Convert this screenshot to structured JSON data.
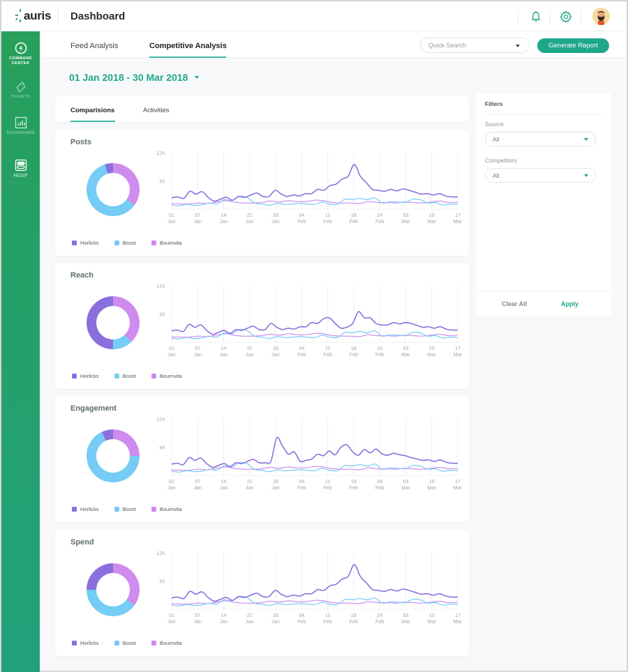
{
  "app": {
    "logo": "auris",
    "page_title": "Dashboard"
  },
  "colors": {
    "brand": "#1fa78a",
    "horlicks": "#8a6fdd",
    "boost": "#75ccf5",
    "bournvita": "#cd8cee"
  },
  "sidebar": {
    "items": [
      {
        "label": "COMMAND CENTER",
        "icon": "bolt-icon",
        "active": true
      },
      {
        "label": "TICKETS",
        "icon": "ticket-icon",
        "active": false
      },
      {
        "label": "DASHBOARD",
        "icon": "bar-chart-icon",
        "active": false
      },
      {
        "label": "SETUP",
        "icon": "toggle-icon",
        "active": false
      }
    ]
  },
  "subnav": {
    "tabs": [
      {
        "label": "Feed Analysis"
      },
      {
        "label": "Competitive Analysis"
      }
    ],
    "search_placeholder": "Quick Search",
    "generate_label": "Generate Report"
  },
  "date_range": "01 Jan 2018 - 30 Mar 2018",
  "content_tabs": [
    {
      "label": "Comparisions"
    },
    {
      "label": "Activities"
    }
  ],
  "filters": {
    "title": "Filters",
    "source_label": "Source",
    "source_value": "All",
    "competitors_label": "Competitors",
    "competitors_value": "All",
    "clear_label": "Clear All",
    "apply_label": "Apply"
  },
  "legend": [
    "Horlicks",
    "Boost",
    "Bournvita"
  ],
  "chart_data": [
    {
      "type": "line",
      "title": "Posts",
      "donut": {
        "type": "pie",
        "values": [
          5,
          60,
          35
        ],
        "labels": [
          "Horlicks",
          "Boost",
          "Bournvita"
        ]
      },
      "x": [
        "01 Jan",
        "07 Jan",
        "14 Jan",
        "21 Jan",
        "28 Jan",
        "04 Feb",
        "11 Feb",
        "18 Feb",
        "24 Feb",
        "03 Mar",
        "10 Mar",
        "17 Mar"
      ],
      "y_ticks": [
        "12K",
        "6K"
      ],
      "ylim": [
        0,
        12000
      ],
      "series": [
        {
          "name": "Horlicks",
          "values": [
            2400,
            2600,
            2300,
            3800,
            3200,
            3700,
            2500,
            1700,
            2100,
            2500,
            1900,
            2700,
            2500,
            3000,
            3400,
            2700,
            2700,
            4000,
            3200,
            2700,
            3000,
            2800,
            3300,
            3300,
            4200,
            4000,
            5000,
            5300,
            6400,
            7000,
            9500,
            7000,
            5600,
            4200,
            4000,
            3800,
            4200,
            3900,
            4300,
            4000,
            3600,
            3200,
            3300,
            3000,
            3300,
            2800,
            2600,
            2600
          ]
        },
        {
          "name": "Boost",
          "values": [
            900,
            700,
            1000,
            800,
            900,
            1300,
            1100,
            2000,
            1800,
            2700,
            2500,
            1300,
            1100,
            800,
            1200,
            1000,
            1100,
            1200,
            1100,
            1000,
            1500,
            1100,
            1000,
            2100,
            2000,
            2300,
            2000,
            2400,
            1300,
            1600,
            1500,
            1400,
            2100,
            2000,
            1300,
            1400,
            900,
            1100,
            1000
          ]
        },
        {
          "name": "Bournvita",
          "values": [
            1200,
            1100,
            1100,
            1300,
            1200,
            1500,
            1800,
            1500,
            1300,
            1300,
            1400,
            1700,
            1500,
            1800,
            1600,
            1600,
            1900,
            1800,
            1400,
            1300,
            1300,
            1200,
            1600,
            1400,
            1400,
            1300,
            1500,
            1400,
            1300,
            1500,
            1700,
            1400,
            1500
          ]
        }
      ]
    },
    {
      "type": "line",
      "title": "Reach",
      "donut": {
        "type": "pie",
        "values": [
          50,
          12,
          38
        ],
        "labels": [
          "Horlicks",
          "Boost",
          "Bournvita"
        ]
      },
      "x": [
        "01 Jan",
        "07 Jan",
        "14 Jan",
        "21 Jan",
        "28 Jan",
        "04 Feb",
        "11 Feb",
        "18 Feb",
        "24 Feb",
        "03 Mar",
        "10 Mar",
        "17 Mar"
      ],
      "y_ticks": [
        "12K",
        "6K"
      ],
      "ylim": [
        0,
        12000
      ],
      "series": [
        {
          "name": "Horlicks",
          "values": [
            2400,
            2600,
            2300,
            3800,
            3200,
            3700,
            2500,
            1700,
            2100,
            2500,
            1900,
            2700,
            2500,
            3000,
            3400,
            2700,
            2700,
            4000,
            3200,
            2700,
            3000,
            2800,
            3300,
            3300,
            4200,
            4000,
            5000,
            5200,
            4000,
            3000,
            3200,
            4000,
            6500,
            5200,
            5200,
            4000,
            3700,
            3700,
            4200,
            3900,
            4200,
            4000,
            3600,
            3200,
            3300,
            3000,
            3300,
            2800,
            2600,
            2600
          ]
        },
        {
          "name": "Boost",
          "values": [
            900,
            700,
            1000,
            800,
            900,
            1300,
            1100,
            2000,
            1800,
            2700,
            2500,
            1300,
            1100,
            800,
            1200,
            1000,
            1100,
            1200,
            1100,
            1000,
            1500,
            1100,
            1000,
            2100,
            2000,
            2300,
            2000,
            2400,
            1300,
            1600,
            1500,
            1400,
            2100,
            2000,
            1300,
            1400,
            900,
            1100,
            1000
          ]
        },
        {
          "name": "Bournvita",
          "values": [
            1200,
            1100,
            1100,
            1300,
            1200,
            1500,
            1800,
            1500,
            1300,
            1300,
            1400,
            1700,
            1500,
            1800,
            1600,
            1600,
            1900,
            1800,
            1400,
            1300,
            1300,
            1200,
            1600,
            1400,
            1400,
            1300,
            1500,
            1400,
            1300,
            1500,
            1700,
            1400,
            1500
          ]
        }
      ]
    },
    {
      "type": "line",
      "title": "Engagement",
      "donut": {
        "type": "pie",
        "values": [
          7,
          68,
          25
        ],
        "labels": [
          "Horlicks",
          "Boost",
          "Bournvita"
        ]
      },
      "x": [
        "01 Jan",
        "07 Jan",
        "14 Jan",
        "21 Jan",
        "28 Jan",
        "04 Feb",
        "11 Feb",
        "18 Feb",
        "24 Feb",
        "03 Mar",
        "10 Mar",
        "17 Mar"
      ],
      "y_ticks": [
        "12K",
        "6K"
      ],
      "ylim": [
        0,
        12000
      ],
      "series": [
        {
          "name": "Horlicks",
          "values": [
            2400,
            2600,
            2300,
            3800,
            3200,
            3700,
            2500,
            1700,
            2100,
            2500,
            1900,
            2700,
            2500,
            3000,
            3400,
            2700,
            2700,
            3000,
            8000,
            6200,
            4500,
            5000,
            3000,
            3200,
            3500,
            4500,
            4200,
            5200,
            4400,
            6000,
            6500,
            5000,
            4300,
            5500,
            4800,
            5600,
            4600,
            4300,
            4700,
            4400,
            4200,
            3800,
            3500,
            3200,
            3300,
            3000,
            3300,
            2800,
            2600,
            2600
          ]
        },
        {
          "name": "Boost",
          "values": [
            900,
            700,
            1000,
            800,
            900,
            1300,
            1100,
            2000,
            1800,
            2700,
            2500,
            1300,
            1100,
            800,
            1200,
            1000,
            1100,
            1200,
            1100,
            1000,
            1500,
            1100,
            1000,
            2100,
            2000,
            2300,
            2000,
            2400,
            1300,
            1600,
            1500,
            1400,
            2100,
            2000,
            1300,
            1400,
            900,
            1100,
            1000
          ]
        },
        {
          "name": "Bournvita",
          "values": [
            1200,
            1100,
            1100,
            1300,
            1200,
            1500,
            1800,
            1500,
            1300,
            1300,
            1400,
            1700,
            1500,
            1800,
            1600,
            1600,
            1900,
            1800,
            1400,
            1300,
            1300,
            1200,
            1600,
            1400,
            1400,
            1300,
            1500,
            1400,
            1300,
            1500,
            1700,
            1400,
            1500
          ]
        }
      ]
    },
    {
      "type": "line",
      "title": "Spend",
      "donut": {
        "type": "pie",
        "values": [
          25,
          40,
          35
        ],
        "labels": [
          "Horlicks",
          "Boost",
          "Bournvita"
        ]
      },
      "x": [
        "01 Jan",
        "07 Jan",
        "14 Jan",
        "21 Jan",
        "28 Jan",
        "04 Feb",
        "11 Feb",
        "18 Feb",
        "24 Feb",
        "03 Mar",
        "10 Mar",
        "17 Mar"
      ],
      "y_ticks": [
        "12K",
        "6K"
      ],
      "ylim": [
        0,
        12000
      ],
      "series": [
        {
          "name": "Horlicks",
          "values": [
            2400,
            2600,
            2300,
            3800,
            3200,
            3700,
            2500,
            1700,
            2100,
            2500,
            1900,
            2700,
            2500,
            3000,
            3400,
            2700,
            2700,
            4000,
            3200,
            2700,
            3000,
            2800,
            3300,
            3300,
            4200,
            4000,
            5000,
            5300,
            6400,
            7000,
            9500,
            7000,
            5600,
            4200,
            4000,
            3800,
            4200,
            3900,
            4300,
            4000,
            3600,
            3200,
            3300,
            3000,
            3300,
            2800,
            2600,
            2600
          ]
        },
        {
          "name": "Boost",
          "values": [
            900,
            700,
            1000,
            800,
            900,
            1300,
            1100,
            2000,
            1800,
            2700,
            2500,
            1300,
            1100,
            800,
            1200,
            1000,
            1100,
            1200,
            1100,
            1000,
            1500,
            1100,
            1000,
            2100,
            2000,
            2300,
            2000,
            2400,
            1300,
            1600,
            1500,
            1400,
            2100,
            2000,
            1300,
            1400,
            900,
            1100,
            1000
          ]
        },
        {
          "name": "Bournvita",
          "values": [
            1200,
            1100,
            1100,
            1300,
            1200,
            1500,
            1800,
            1500,
            1300,
            1300,
            1400,
            1700,
            1500,
            1800,
            1600,
            1600,
            1900,
            1800,
            1400,
            1300,
            1300,
            1200,
            1600,
            1400,
            1400,
            1300,
            1500,
            1400,
            1300,
            1500,
            1700,
            1400,
            1500
          ]
        }
      ]
    }
  ]
}
